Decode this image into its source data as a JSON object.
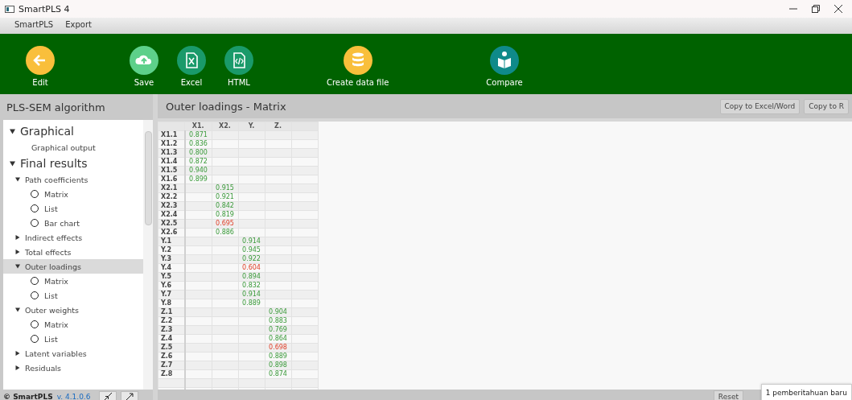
{
  "window": {
    "title": "SmartPLS 4"
  },
  "menu": [
    "SmartPLS",
    "Export"
  ],
  "toolbar": [
    {
      "label": "Edit",
      "kind": "back"
    },
    {
      "label": "Save",
      "kind": "cloud"
    },
    {
      "label": "Excel",
      "kind": "excel"
    },
    {
      "label": "HTML",
      "kind": "html"
    },
    {
      "label": "Create data file",
      "kind": "database"
    },
    {
      "label": "Compare",
      "kind": "book"
    }
  ],
  "sidebar": {
    "title": "PLS-SEM algorithm",
    "items": [
      {
        "label": "Graphical",
        "kind": "section",
        "expanded": true,
        "selected": false,
        "children": [
          {
            "label": "Graphical output",
            "kind": "link",
            "selected": false
          }
        ]
      },
      {
        "label": "Final results",
        "kind": "section",
        "expanded": true,
        "selected": false,
        "children": [
          {
            "label": "Path coefficients",
            "kind": "group",
            "expanded": true,
            "selected": false,
            "children": [
              {
                "label": "Matrix",
                "kind": "option",
                "selected": false
              },
              {
                "label": "List",
                "kind": "option",
                "selected": false
              },
              {
                "label": "Bar chart",
                "kind": "option",
                "selected": false
              }
            ]
          },
          {
            "label": "Indirect effects",
            "kind": "group",
            "expanded": false,
            "selected": false
          },
          {
            "label": "Total effects",
            "kind": "group",
            "expanded": false,
            "selected": false
          },
          {
            "label": "Outer loadings",
            "kind": "group",
            "expanded": true,
            "selected": true,
            "children": [
              {
                "label": "Matrix",
                "kind": "option",
                "selected": false
              },
              {
                "label": "List",
                "kind": "option",
                "selected": false
              }
            ]
          },
          {
            "label": "Outer weights",
            "kind": "group",
            "expanded": true,
            "selected": false,
            "children": [
              {
                "label": "Matrix",
                "kind": "option",
                "selected": false
              },
              {
                "label": "List",
                "kind": "option",
                "selected": false
              }
            ]
          },
          {
            "label": "Latent variables",
            "kind": "group",
            "expanded": false,
            "selected": false
          },
          {
            "label": "Residuals",
            "kind": "group",
            "expanded": false,
            "selected": false
          }
        ]
      }
    ],
    "footer": {
      "brand": "© SmartPLS",
      "version": "v. 4.1.0.6"
    }
  },
  "main": {
    "title": "Outer loadings - Matrix",
    "buttons": [
      "Copy to Excel/Word",
      "Copy to R"
    ],
    "table": {
      "groups": [
        {
          "column": "X1.",
          "rows": [
            {
              "label": "X1.1",
              "value": "0.871",
              "below_threshold": false
            },
            {
              "label": "X1.2",
              "value": "0.836",
              "below_threshold": false
            },
            {
              "label": "X1.3",
              "value": "0.800",
              "below_threshold": false
            },
            {
              "label": "X1.4",
              "value": "0.872",
              "below_threshold": false
            },
            {
              "label": "X1.5",
              "value": "0.940",
              "below_threshold": false
            },
            {
              "label": "X1.6",
              "value": "0.899",
              "below_threshold": false
            }
          ]
        },
        {
          "column": "X2.",
          "rows": [
            {
              "label": "X2.1",
              "value": "0.915",
              "below_threshold": false
            },
            {
              "label": "X2.2",
              "value": "0.921",
              "below_threshold": false
            },
            {
              "label": "X2.3",
              "value": "0.842",
              "below_threshold": false
            },
            {
              "label": "X2.4",
              "value": "0.819",
              "below_threshold": false
            },
            {
              "label": "X2.5",
              "value": "0.695",
              "below_threshold": true
            },
            {
              "label": "X2.6",
              "value": "0.886",
              "below_threshold": false
            }
          ]
        },
        {
          "column": "Y.",
          "rows": [
            {
              "label": "Y.1",
              "value": "0.914",
              "below_threshold": false
            },
            {
              "label": "Y.2",
              "value": "0.945",
              "below_threshold": false
            },
            {
              "label": "Y.3",
              "value": "0.922",
              "below_threshold": false
            },
            {
              "label": "Y.4",
              "value": "0.604",
              "below_threshold": true
            },
            {
              "label": "Y.5",
              "value": "0.894",
              "below_threshold": false
            },
            {
              "label": "Y.6",
              "value": "0.832",
              "below_threshold": false
            },
            {
              "label": "Y.7",
              "value": "0.914",
              "below_threshold": false
            },
            {
              "label": "Y.8",
              "value": "0.889",
              "below_threshold": false
            }
          ]
        },
        {
          "column": "Z.",
          "rows": [
            {
              "label": "Z.1",
              "value": "0.904",
              "below_threshold": false
            },
            {
              "label": "Z.2",
              "value": "0.883",
              "below_threshold": false
            },
            {
              "label": "Z.3",
              "value": "0.769",
              "below_threshold": false
            },
            {
              "label": "Z.4",
              "value": "0.864",
              "below_threshold": false
            },
            {
              "label": "Z.5",
              "value": "0.698",
              "below_threshold": true
            },
            {
              "label": "Z.6",
              "value": "0.889",
              "below_threshold": false
            },
            {
              "label": "Z.7",
              "value": "0.898",
              "below_threshold": false
            },
            {
              "label": "Z.8",
              "value": "0.874",
              "below_threshold": false
            }
          ]
        }
      ]
    },
    "bottom_buttons": [
      "Reset"
    ]
  },
  "notification": {
    "text": "1 pemberitahuan baru"
  }
}
